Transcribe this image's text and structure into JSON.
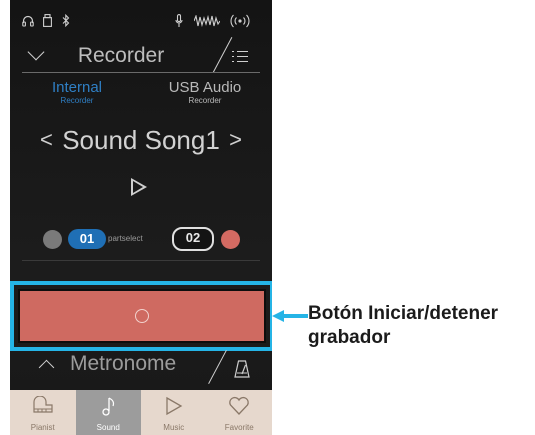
{
  "status_icons": [
    "headphones-icon",
    "usb-drive-icon",
    "bluetooth-icon",
    "microphone-icon",
    "audio-signal-icon",
    "wireless-icon"
  ],
  "header": {
    "title": "Recorder"
  },
  "tabs": [
    {
      "label": "Internal",
      "sub": "Recorder",
      "active": true
    },
    {
      "label": "USB Audio",
      "sub": "Recorder",
      "active": false
    }
  ],
  "song": {
    "prev": "<",
    "name": "Sound Song1",
    "next": ">"
  },
  "parts": {
    "part1": "01",
    "select_label": "partselect",
    "part2": "02"
  },
  "record_button": {
    "state": "ready"
  },
  "metronome": {
    "label": "Metronome"
  },
  "nav": [
    {
      "label": "Pianist",
      "icon": "piano-icon",
      "active": false
    },
    {
      "label": "Sound",
      "icon": "music-note-icon",
      "active": true
    },
    {
      "label": "Music",
      "icon": "play-icon",
      "active": false
    },
    {
      "label": "Favorite",
      "icon": "heart-icon",
      "active": false
    }
  ],
  "callout": {
    "text": "Botón Iniciar/detener grabador"
  },
  "colors": {
    "highlight": "#25b4e6",
    "record": "#cf6a61",
    "active_tab": "#2f7fc4",
    "nav_bg": "#e6d8cd",
    "nav_active": "#9c9c9c"
  }
}
